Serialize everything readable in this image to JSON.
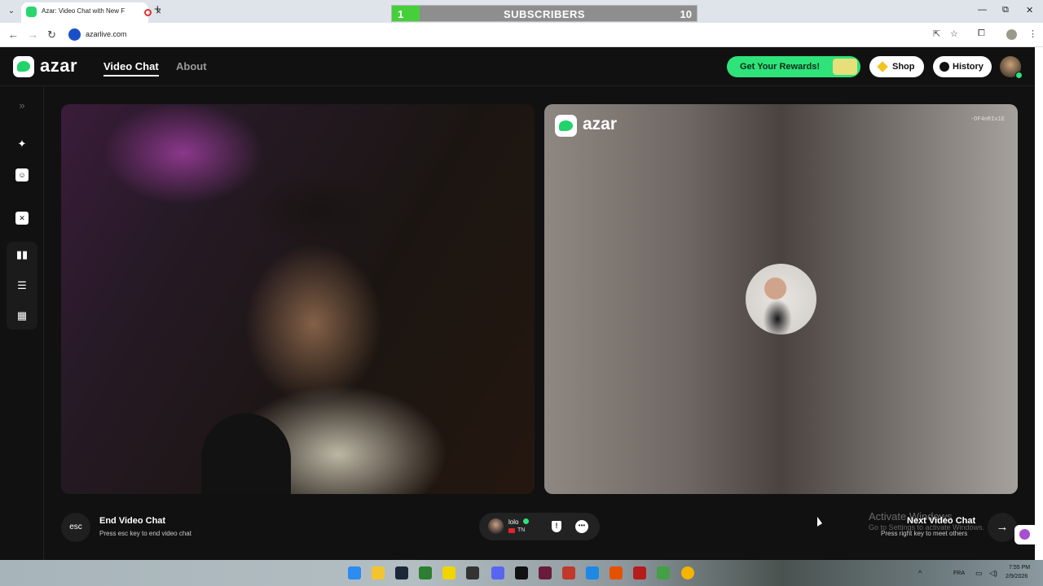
{
  "browser": {
    "tab_title": "Azar: Video Chat with New F",
    "url": "azarlive.com",
    "subscriber_goal": {
      "start": "1",
      "label": "SUBSCRIBERS",
      "end": "10"
    }
  },
  "header": {
    "logo": "azar",
    "nav": [
      "Video Chat",
      "About"
    ],
    "rewards_label": "Get Your Rewards!",
    "shop_label": "Shop",
    "history_label": "History"
  },
  "partner_panel": {
    "watermark": "azar",
    "code": "-OF4nRIx1E"
  },
  "controls": {
    "esc_key": "esc",
    "end_title": "End Video Chat",
    "end_hint": "Press esc key to end video chat",
    "next_title": "Next Video Chat",
    "next_hint": "Press right key to meet others"
  },
  "partner": {
    "name": "lolo",
    "country": "TN"
  },
  "overlay": {
    "activate_title": "Activate Windows",
    "activate_hint": "Go to Settings to activate Windows."
  },
  "taskbar": {
    "language": "FRA",
    "time": "7:55 PM",
    "date": "2/9/2026"
  },
  "colors": {
    "accent_green": "#2ee37a",
    "background": "#111111"
  }
}
